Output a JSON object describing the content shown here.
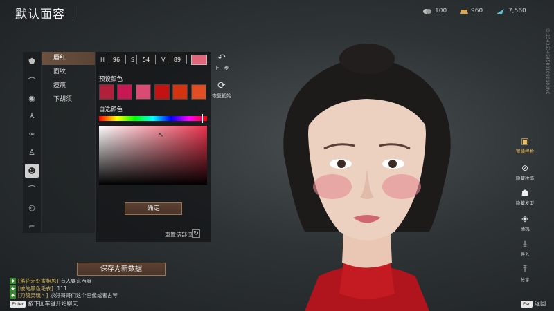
{
  "title": "默认面容",
  "resources": [
    {
      "icon": "coin-icon",
      "value": "100",
      "color": "#bfbfbf"
    },
    {
      "icon": "gold-bar-icon",
      "value": "960",
      "color": "#d9a55a"
    },
    {
      "icon": "feather-icon",
      "value": "7,560",
      "color": "#5fc2d6"
    }
  ],
  "sub_nav": [
    "唇红",
    "面纹",
    "痘痕",
    "下胡须"
  ],
  "hsv": {
    "h_label": "H",
    "h": "96",
    "s_label": "S",
    "s": "54",
    "v_label": "V",
    "v": "89"
  },
  "preset_label": "预设颜色",
  "custom_label": "自选颜色",
  "preset_colors": [
    "#b21f3b",
    "#c61953",
    "#d94b73",
    "#c21212",
    "#d3330f",
    "#e24e24"
  ],
  "current_color": "#e0667c",
  "confirm_label": "确定",
  "reset_part_label": "重置该部位",
  "undo_label": "上一步",
  "restore_label": "恢复初始",
  "save_label": "保存为新数据",
  "chat": [
    {
      "channel": "[落花无处寄相思]",
      "text": " 有人要东西嘛"
    },
    {
      "channel": "[被的黑色毛衣]",
      "text": ":111"
    },
    {
      "channel": "[刀鸽灵魂丶]",
      "text": " 求好哥哥们这个画像或者古琴"
    }
  ],
  "enter_key": "Enter",
  "enter_hint": "按下回车键开始聊天",
  "esc_key": "Esc",
  "esc_label": "返回",
  "right_tools": [
    {
      "icon": "smart-capture-icon",
      "label": "智能捏脸"
    },
    {
      "icon": "hide-makeup-icon",
      "label": "隐藏妆饰"
    },
    {
      "icon": "hide-hair-icon",
      "label": "隐藏发型"
    },
    {
      "icon": "random-icon",
      "label": "随机"
    },
    {
      "icon": "import-icon",
      "label": "导入"
    },
    {
      "icon": "share-icon",
      "label": "分享"
    }
  ],
  "vertical_id": "ID:2343534545801090100NC"
}
